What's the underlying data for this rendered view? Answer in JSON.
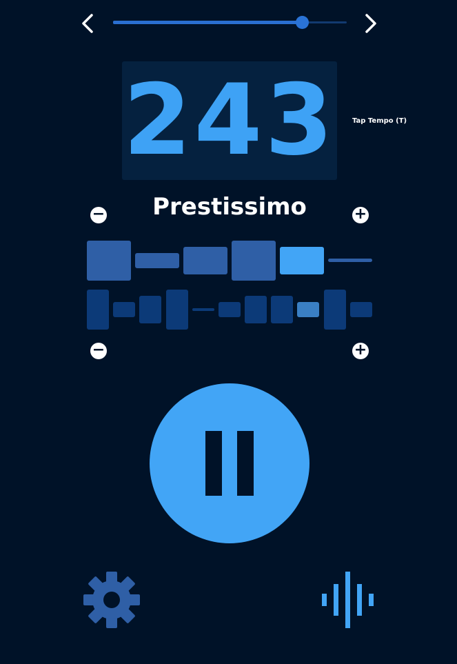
{
  "slider": {
    "prev_label": "previous",
    "next_label": "next",
    "value": 0.81
  },
  "display": {
    "bpm": "243",
    "tap_tempo_label": "Tap Tempo (T)",
    "tempo_name": "Prestissimo"
  },
  "beats": {
    "decrease_label": "−",
    "increase_label": "+",
    "top_row_accents": [
      "strong",
      "medium",
      "strong",
      "strong",
      "active",
      "off"
    ],
    "bottom_row_accents": [
      "strong",
      "medium",
      "strong",
      "strong",
      "off",
      "medium",
      "strong",
      "strong",
      "active",
      "strong",
      "medium"
    ]
  },
  "controls": {
    "play_state": "playing",
    "settings_icon": "gear-icon",
    "sound_icon": "sound-wave-icon"
  },
  "colors": {
    "background": "#001228",
    "accent": "#42a5f6",
    "beat_top": "#2f5fa6",
    "beat_active": "#42a5f6",
    "beat_bottom": "#0c3a78",
    "beat_bottom_active": "#3a7fc4"
  }
}
